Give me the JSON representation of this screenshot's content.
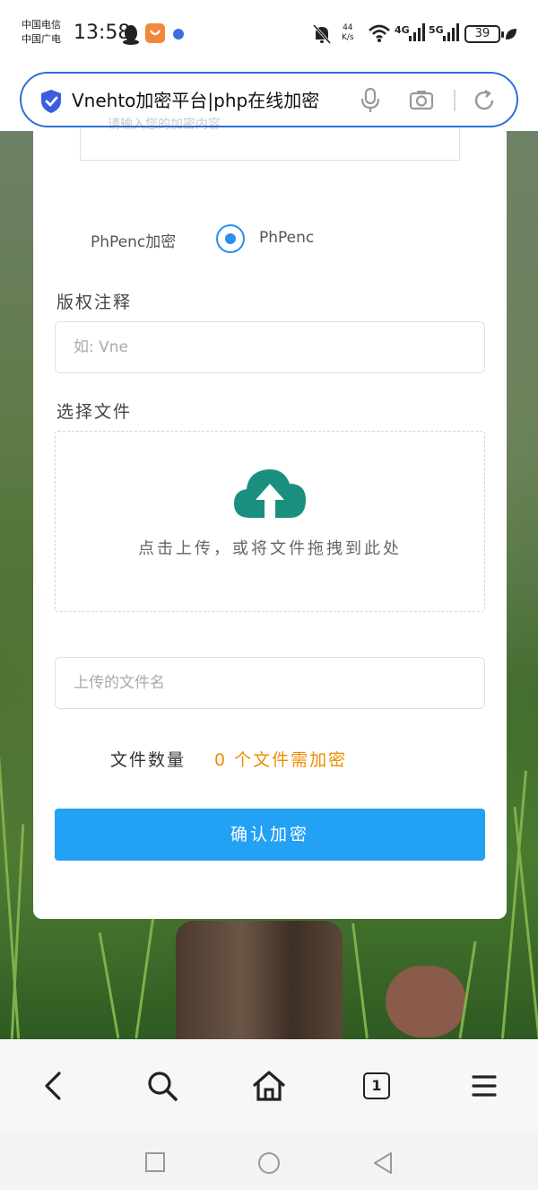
{
  "status_bar": {
    "carrier_line1": "中国电信",
    "carrier_line2": "中国广电",
    "time": "13:58",
    "speed_value": "44",
    "speed_unit": "K/s",
    "net1": "4G",
    "net2": "5G",
    "battery": "39"
  },
  "address_bar": {
    "page_title": "Vnehto加密平台|php在线加密"
  },
  "form": {
    "previous_field_text": "请输入您的加密内容",
    "radio_label": "PhPenc加密",
    "radio_option": "PhPenc",
    "copyright_label": "版权注释",
    "copyright_placeholder": "如: Vne",
    "choose_file_label": "选择文件",
    "upload_hint": "点击上传，或将文件拖拽到此处",
    "filename_placeholder": "上传的文件名",
    "file_count_label": "文件数量",
    "file_count_value": "0 个文件需加密",
    "confirm_button": "确认加密"
  },
  "toolbar": {
    "tab_count": "1"
  },
  "colors": {
    "accent_blue": "#22a1f5",
    "radio_blue": "#2a8ef0",
    "cloud_teal": "#1a8f7f",
    "count_orange": "#f08c00",
    "address_border": "#2f6fd6"
  }
}
